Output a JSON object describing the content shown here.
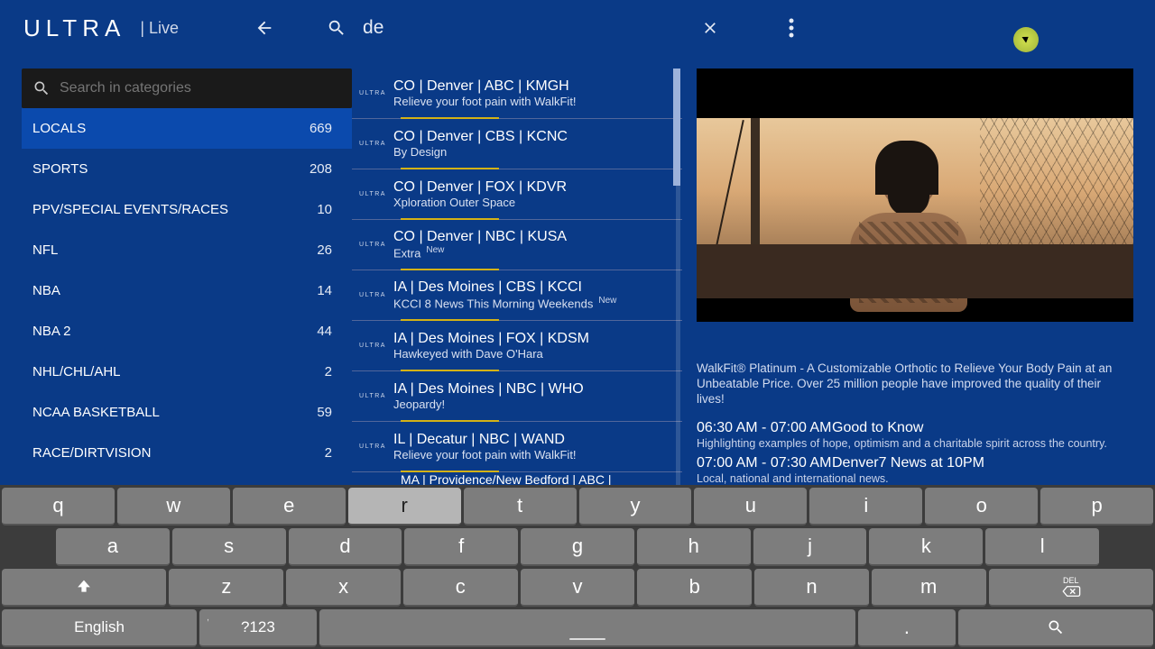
{
  "header": {
    "logo": "ULTRA",
    "section": "| Live",
    "search_value": "de"
  },
  "category_search": {
    "placeholder": "Search in categories"
  },
  "categories": [
    {
      "name": "LOCALS",
      "count": "669",
      "selected": true
    },
    {
      "name": "SPORTS",
      "count": "208"
    },
    {
      "name": "PPV/SPECIAL EVENTS/RACES",
      "count": "10"
    },
    {
      "name": "NFL",
      "count": "26"
    },
    {
      "name": "NBA",
      "count": "14"
    },
    {
      "name": "NBA 2",
      "count": "44"
    },
    {
      "name": "NHL/CHL/AHL",
      "count": "2"
    },
    {
      "name": "NCAA BASKETBALL",
      "count": "59"
    },
    {
      "name": "RACE/DIRTVISION",
      "count": "2"
    }
  ],
  "channels": [
    {
      "title": "CO | Denver | ABC | KMGH",
      "sub": "Relieve your foot pain with WalkFit!"
    },
    {
      "title": "CO | Denver | CBS | KCNC",
      "sub": "By Design"
    },
    {
      "title": "CO | Denver | FOX | KDVR",
      "sub": "Xploration Outer Space"
    },
    {
      "title": "CO | Denver | NBC | KUSA",
      "sub": "Extra",
      "badge": "New"
    },
    {
      "title": "IA | Des Moines | CBS | KCCI",
      "sub": "KCCI 8 News This Morning Weekends",
      "badge": "New"
    },
    {
      "title": "IA | Des Moines | FOX | KDSM",
      "sub": "Hawkeyed with Dave O'Hara"
    },
    {
      "title": "IA | Des Moines | NBC | WHO",
      "sub": "Jeopardy!"
    },
    {
      "title": "IL | Decatur | NBC | WAND",
      "sub": "Relieve your foot pain with WalkFit!"
    }
  ],
  "channel_peek": "MA | Providence/New Bedford | ABC |",
  "channel_logo_text": "ULTRA",
  "preview": {
    "description": "WalkFit® Platinum - A Customizable Orthotic to Relieve Your Body Pain at an Unbeatable Price. Over 25 million people have improved the quality of their lives!",
    "schedule": [
      {
        "time": "06:30 AM - 07:00 AM",
        "title": "Good to Know",
        "desc": "Highlighting examples of hope, optimism and a charitable spirit across the country."
      },
      {
        "time": "07:00 AM - 07:30 AM",
        "title": "Denver7 News at 10PM",
        "desc": "Local, national and international news."
      }
    ]
  },
  "keyboard": {
    "row1": [
      "q",
      "w",
      "e",
      "r",
      "t",
      "y",
      "u",
      "i",
      "o",
      "p"
    ],
    "row2": [
      "a",
      "s",
      "d",
      "f",
      "g",
      "h",
      "j",
      "k",
      "l"
    ],
    "row3_mid": [
      "z",
      "x",
      "c",
      "v",
      "b",
      "n",
      "m"
    ],
    "english": "English",
    "symnum": "?123",
    "dot": ".",
    "del_top": "DEL",
    "highlighted": "r"
  }
}
